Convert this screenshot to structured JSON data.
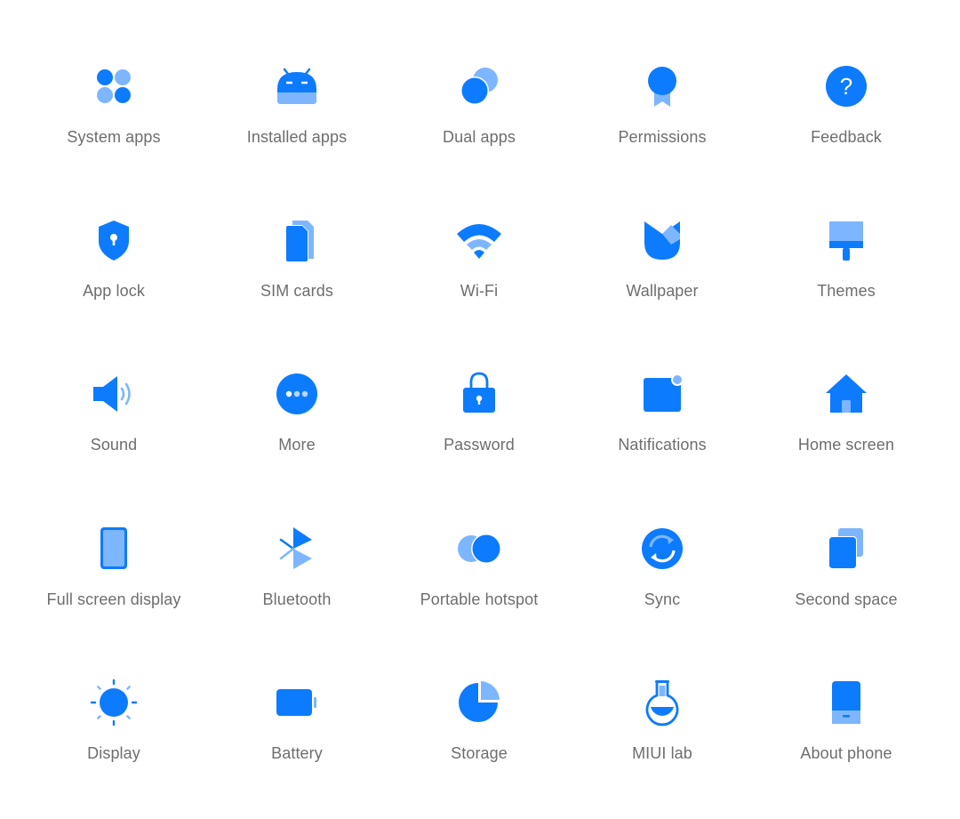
{
  "colors": {
    "primary": "#0d7bfd",
    "secondary": "#7db6ff",
    "label": "#6e6e6e"
  },
  "tiles": [
    {
      "label": "System apps",
      "icon": "system-apps-icon"
    },
    {
      "label": "Installed apps",
      "icon": "installed-apps-icon"
    },
    {
      "label": "Dual apps",
      "icon": "dual-apps-icon"
    },
    {
      "label": "Permissions",
      "icon": "permissions-icon"
    },
    {
      "label": "Feedback",
      "icon": "feedback-icon"
    },
    {
      "label": "App lock",
      "icon": "app-lock-icon"
    },
    {
      "label": "SIM cards",
      "icon": "sim-cards-icon"
    },
    {
      "label": "Wi-Fi",
      "icon": "wifi-icon"
    },
    {
      "label": "Wallpaper",
      "icon": "wallpaper-icon"
    },
    {
      "label": "Themes",
      "icon": "themes-icon"
    },
    {
      "label": "Sound",
      "icon": "sound-icon"
    },
    {
      "label": "More",
      "icon": "more-icon"
    },
    {
      "label": "Password",
      "icon": "password-icon"
    },
    {
      "label": "Natifications",
      "icon": "notifications-icon"
    },
    {
      "label": "Home screen",
      "icon": "home-screen-icon"
    },
    {
      "label": "Full screen display",
      "icon": "full-screen-display-icon"
    },
    {
      "label": "Bluetooth",
      "icon": "bluetooth-icon"
    },
    {
      "label": "Portable hotspot",
      "icon": "portable-hotspot-icon"
    },
    {
      "label": "Sync",
      "icon": "sync-icon"
    },
    {
      "label": "Second space",
      "icon": "second-space-icon"
    },
    {
      "label": "Display",
      "icon": "display-icon"
    },
    {
      "label": "Battery",
      "icon": "battery-icon"
    },
    {
      "label": "Storage",
      "icon": "storage-icon"
    },
    {
      "label": "MIUI lab",
      "icon": "miui-lab-icon"
    },
    {
      "label": "About phone",
      "icon": "about-phone-icon"
    }
  ]
}
